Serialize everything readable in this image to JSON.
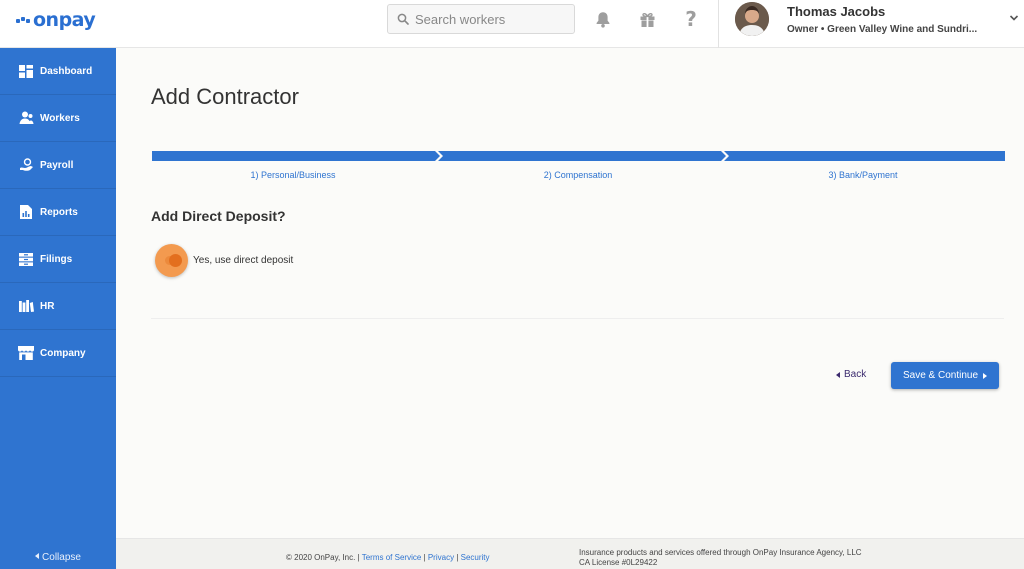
{
  "brand": {
    "logo_text": "onpay",
    "accent": "#2f74d0",
    "toggle_color": "#f39a4f"
  },
  "header": {
    "search_placeholder": "Search workers",
    "icons": [
      "bell-icon",
      "gift-icon",
      "help-icon"
    ],
    "help_glyph": "?",
    "user": {
      "name": "Thomas Jacobs",
      "role_company": "Owner • Green Valley Wine and Sundri..."
    }
  },
  "sidebar": {
    "items": [
      {
        "label": "Dashboard",
        "icon": "dashboard-icon"
      },
      {
        "label": "Workers",
        "icon": "workers-icon"
      },
      {
        "label": "Payroll",
        "icon": "payroll-icon"
      },
      {
        "label": "Reports",
        "icon": "reports-icon"
      },
      {
        "label": "Filings",
        "icon": "filings-icon"
      },
      {
        "label": "HR",
        "icon": "hr-icon"
      },
      {
        "label": "Company",
        "icon": "company-icon"
      }
    ],
    "collapse_label": "Collapse"
  },
  "main": {
    "title": "Add Contractor",
    "steps": [
      {
        "label": "1) Personal/Business"
      },
      {
        "label": "2) Compensation"
      },
      {
        "label": "3) Bank/Payment"
      }
    ],
    "section_title": "Add Direct Deposit?",
    "toggle_label": "Yes, use direct deposit",
    "back_label": "Back",
    "save_label": "Save & Continue"
  },
  "footer": {
    "copyright": "© 2020 OnPay, Inc. |",
    "terms": "Terms of Service",
    "sep1": "|",
    "privacy": "Privacy",
    "sep2": "|",
    "security": "Security",
    "insurance_line1": "Insurance products and services offered through OnPay Insurance Agency, LLC",
    "insurance_line2": "CA License #0L29422"
  }
}
